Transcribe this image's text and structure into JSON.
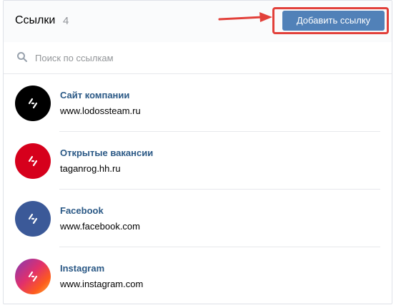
{
  "header": {
    "title": "Ссылки",
    "count": "4",
    "add_button_label": "Добавить ссылку"
  },
  "search": {
    "placeholder": "Поиск по ссылкам",
    "value": ""
  },
  "links": [
    {
      "title": "Сайт компании",
      "url": "www.lodossteam.ru",
      "icon": "lightning-icon",
      "avatar_color": "#000000"
    },
    {
      "title": "Открытые вакансии",
      "url": "taganrog.hh.ru",
      "icon": "lightning-icon",
      "avatar_color": "#d6001c"
    },
    {
      "title": "Facebook",
      "url": "www.facebook.com",
      "icon": "lightning-icon",
      "avatar_color": "#3b5998"
    },
    {
      "title": "Instagram",
      "url": "www.instagram.com",
      "icon": "lightning-icon",
      "avatar_color": "gradient-instagram"
    }
  ],
  "colors": {
    "accent": "#5181b8",
    "link_title": "#2a5885",
    "highlight": "#e2403a"
  }
}
